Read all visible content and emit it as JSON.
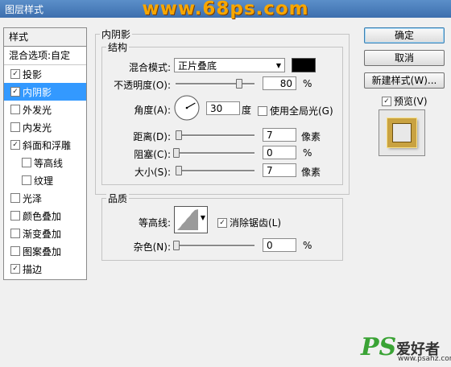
{
  "window": {
    "title": "图层样式",
    "watermark": "www.68ps.com"
  },
  "left_panel": {
    "header": "样式",
    "blend_label": "混合选项:自定",
    "items": [
      {
        "label": "投影",
        "checked": true,
        "selected": false,
        "sub": false
      },
      {
        "label": "内阴影",
        "checked": true,
        "selected": true,
        "sub": false
      },
      {
        "label": "外发光",
        "checked": false,
        "selected": false,
        "sub": false
      },
      {
        "label": "内发光",
        "checked": false,
        "selected": false,
        "sub": false
      },
      {
        "label": "斜面和浮雕",
        "checked": true,
        "selected": false,
        "sub": false
      },
      {
        "label": "等高线",
        "checked": false,
        "selected": false,
        "sub": true
      },
      {
        "label": "纹理",
        "checked": false,
        "selected": false,
        "sub": true
      },
      {
        "label": "光泽",
        "checked": false,
        "selected": false,
        "sub": false
      },
      {
        "label": "颜色叠加",
        "checked": false,
        "selected": false,
        "sub": false
      },
      {
        "label": "渐变叠加",
        "checked": false,
        "selected": false,
        "sub": false
      },
      {
        "label": "图案叠加",
        "checked": false,
        "selected": false,
        "sub": false
      },
      {
        "label": "描边",
        "checked": true,
        "selected": false,
        "sub": false
      }
    ]
  },
  "inner_shadow": {
    "title": "内阴影",
    "structure_title": "结构",
    "blend_mode_label": "混合模式:",
    "blend_mode_value": "正片叠底",
    "color": "#000000",
    "opacity_label": "不透明度(O):",
    "opacity_value": "80",
    "opacity_unit": "%",
    "opacity_level": 0.8,
    "angle_label": "角度(A):",
    "angle_value": "30",
    "angle_unit": "度",
    "global_light_label": "使用全局光(G)",
    "global_light_checked": false,
    "distance_label": "距离(D):",
    "distance_value": "7",
    "distance_unit": "像素",
    "distance_level": 0.03,
    "choke_label": "阻塞(C):",
    "choke_value": "0",
    "choke_unit": "%",
    "choke_level": 0.0,
    "size_label": "大小(S):",
    "size_value": "7",
    "size_unit": "像素",
    "size_level": 0.03
  },
  "quality": {
    "title": "品质",
    "contour_label": "等高线:",
    "antialias_label": "消除锯齿(L)",
    "antialias_checked": true,
    "noise_label": "杂色(N):",
    "noise_value": "0",
    "noise_unit": "%",
    "noise_level": 0.0
  },
  "buttons": {
    "ok": "确定",
    "cancel": "取消",
    "new_style": "新建样式(W)...",
    "preview_label": "预览(V)",
    "preview_checked": true
  },
  "brand": {
    "ps": "PS",
    "cn": "爱好者",
    "url": "www.psahz.com"
  }
}
